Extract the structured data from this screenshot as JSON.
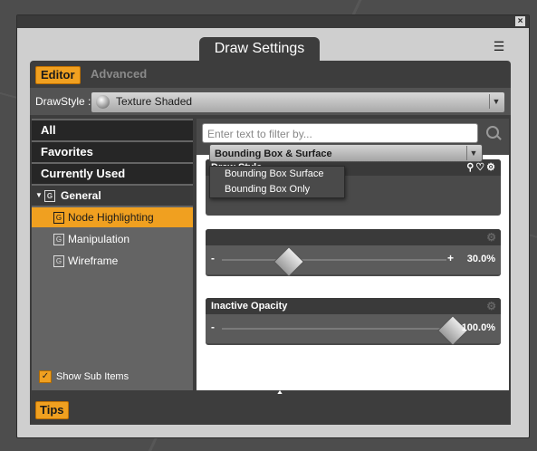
{
  "window": {
    "title": "Draw Settings",
    "close_glyph": "×",
    "menu_glyph": "☰"
  },
  "tabs": {
    "editor": "Editor",
    "advanced": "Advanced"
  },
  "drawstyle": {
    "label": "DrawStyle :",
    "value": "Texture Shaded"
  },
  "sidebar": {
    "items": [
      {
        "label": "All"
      },
      {
        "label": "Favorites"
      },
      {
        "label": "Currently Used"
      },
      {
        "label": "General",
        "badge": "G"
      },
      {
        "label": "Node Highlighting",
        "badge": "G"
      },
      {
        "label": "Manipulation",
        "badge": "G"
      },
      {
        "label": "Wireframe",
        "badge": "G"
      }
    ],
    "show_sub_items": "Show Sub Items"
  },
  "filter": {
    "placeholder": "Enter text to filter by..."
  },
  "properties": {
    "draw_style": {
      "label": "Draw Style",
      "value": "Bounding Box & Surface",
      "options": [
        "Bounding Box  Surface",
        "Bounding Box Only"
      ]
    },
    "active_opacity": {
      "value_text": "30.0%",
      "value": 0.3,
      "minus": "-",
      "plus": "+"
    },
    "inactive_opacity": {
      "label": "Inactive Opacity",
      "value_text": "100.0%",
      "value": 1.0,
      "minus": "-"
    }
  },
  "footer": {
    "tips": "Tips"
  },
  "colors": {
    "accent": "#f0a020",
    "panel": "#3d3d3d"
  }
}
